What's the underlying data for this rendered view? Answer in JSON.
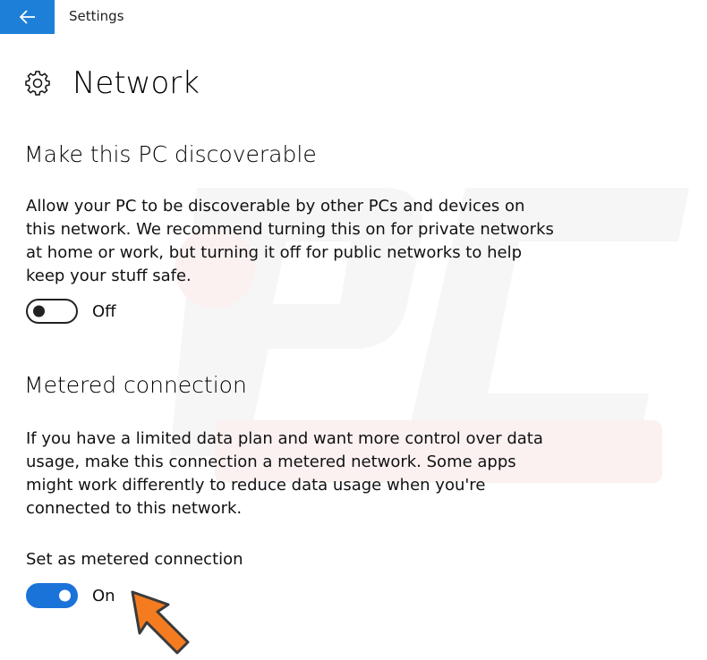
{
  "window": {
    "title": "Settings",
    "back_icon": "back-arrow-icon",
    "accent": "#1e7fd9"
  },
  "page": {
    "title": "Network",
    "icon": "gear-icon"
  },
  "discoverable": {
    "heading": "Make this PC discoverable",
    "description": "Allow your PC to be discoverable by other PCs and devices on this network. We recommend turning this on for private networks at home or work, but turning it off for public networks to help keep your stuff safe.",
    "toggle_state": "Off",
    "enabled": false
  },
  "metered": {
    "heading": "Metered connection",
    "description": "If you have a limited data plan and want more control over data usage, make this connection a metered network. Some apps might work differently to reduce data usage when you're connected to this network.",
    "setting_label": "Set as metered connection",
    "toggle_state": "On",
    "enabled": true,
    "toggle_color": "#1a73d9"
  },
  "annotation": {
    "icon": "pointer-arrow-icon",
    "color": "#f47b20"
  }
}
